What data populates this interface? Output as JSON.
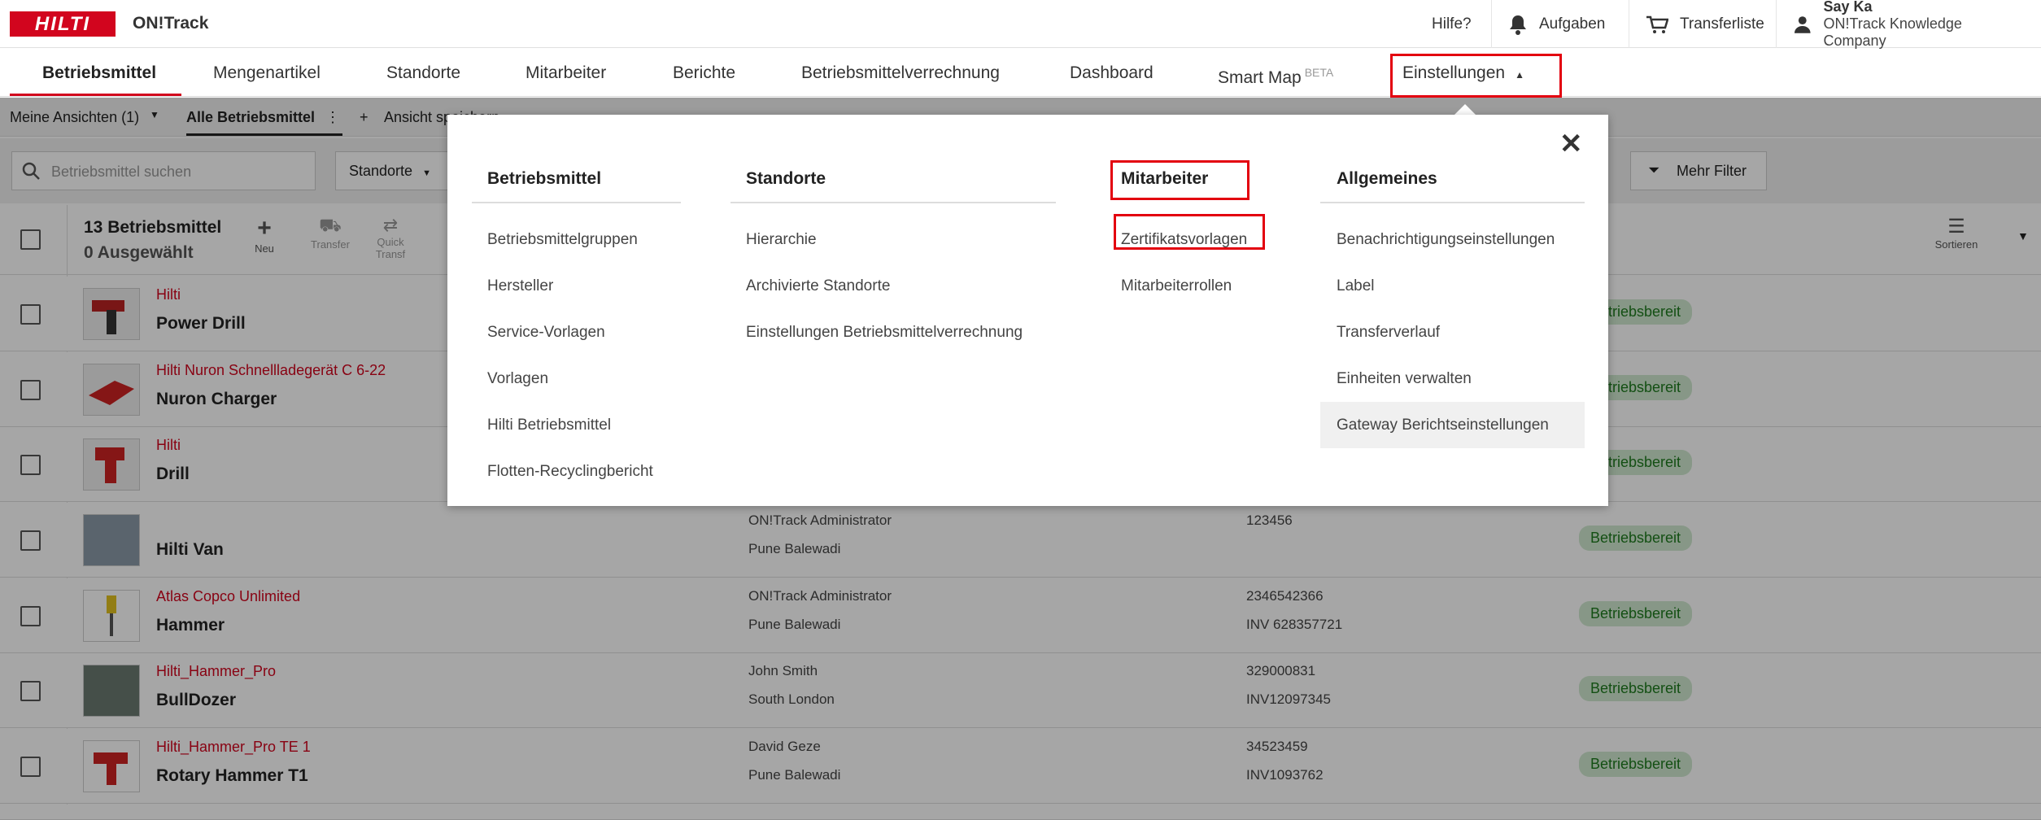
{
  "topbar": {
    "logo": "HILTI",
    "app_name": "ON!Track",
    "help": "Hilfe?",
    "tasks": "Aufgaben",
    "transfer": "Transferliste",
    "user_name": "Say Ka",
    "company": "ON!Track Knowledge Company"
  },
  "nav": {
    "items": [
      "Betriebsmittel",
      "Mengenartikel",
      "Standorte",
      "Mitarbeiter",
      "Berichte",
      "Betriebsmittelverrechnung",
      "Dashboard",
      "Smart Map",
      "Einstellungen"
    ],
    "beta": "BETA"
  },
  "subbar": {
    "views": "Meine Ansichten  (1)",
    "all": "Alle Betriebsmittel",
    "save_view": "Ansicht speichern"
  },
  "filters": {
    "search_placeholder": "Betriebsmittel suchen",
    "locations": "Standorte",
    "more": "Mehr Filter"
  },
  "list": {
    "count": "13 Betriebsmittel",
    "selected": "0 Ausgewählt",
    "actions": [
      "Neu",
      "Transfer",
      "Quick Transf"
    ],
    "sort": "Sortieren",
    "rows": [
      {
        "mfr": "Hilti",
        "model": "Power Drill",
        "c2a": "",
        "c2b": "",
        "c3a": "",
        "c3b": "",
        "status": "Betriebsbereit"
      },
      {
        "mfr": "Hilti Nuron Schnellladegerät C 6-22",
        "model": "Nuron Charger",
        "c2a": "",
        "c2b": "",
        "c3a": "",
        "c3b": "",
        "status": "Betriebsbereit"
      },
      {
        "mfr": "Hilti",
        "model": "Drill",
        "c2a": "",
        "c2b": "",
        "c3a": "",
        "c3b": "",
        "status": "Betriebsbereit"
      },
      {
        "mfr": "",
        "model": "Hilti Van",
        "c2a": "ON!Track Administrator",
        "c2b": "Pune Balewadi",
        "c3a": "123456",
        "c3b": "",
        "status": "Betriebsbereit"
      },
      {
        "mfr": "Atlas Copco Unlimited",
        "model": "Hammer",
        "c2a": "ON!Track Administrator",
        "c2b": "Pune Balewadi",
        "c3a": "2346542366",
        "c3b": "INV 628357721",
        "status": "Betriebsbereit"
      },
      {
        "mfr": "Hilti_Hammer_Pro",
        "model": "BullDozer",
        "c2a": "John Smith",
        "c2b": "South London",
        "c3a": "329000831",
        "c3b": "INV12097345",
        "status": "Betriebsbereit"
      },
      {
        "mfr": "Hilti_Hammer_Pro TE 1",
        "model": "Rotary Hammer T1",
        "c2a": "David Geze",
        "c2b": "Pune Balewadi",
        "c3a": "34523459",
        "c3b": "INV1093762",
        "status": "Betriebsbereit"
      }
    ]
  },
  "menu": {
    "close": "✕",
    "columns": [
      {
        "head": "Betriebsmittel",
        "items": [
          "Betriebsmittelgruppen",
          "Hersteller",
          "Service-Vorlagen",
          "Vorlagen",
          "Hilti Betriebsmittel",
          "Flotten-Recyclingbericht"
        ]
      },
      {
        "head": "Standorte",
        "items": [
          "Hierarchie",
          "Archivierte Standorte",
          "Einstellungen Betriebsmittelverrechnung"
        ]
      },
      {
        "head": "Mitarbeiter",
        "items": [
          "Zertifikatsvorlagen",
          "Mitarbeiterrollen"
        ]
      },
      {
        "head": "Allgemeines",
        "items": [
          "Benachrichtigungseinstellungen",
          "Label",
          "Transferverlauf",
          "Einheiten verwalten",
          "Gateway Berichtseinstellungen"
        ]
      }
    ]
  },
  "colors": {
    "brand": "#d2051e",
    "highlight": "#e3000f"
  }
}
